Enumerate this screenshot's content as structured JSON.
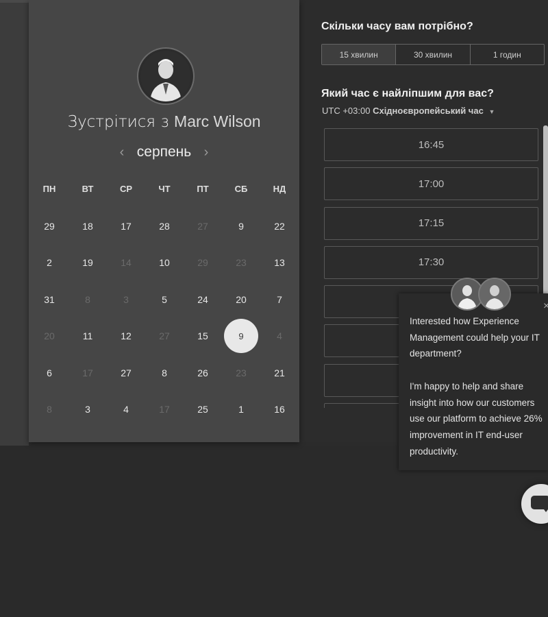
{
  "booking": {
    "title_prefix": "Зустрітися з",
    "host_name": "Marc Wilson",
    "month": "серпень",
    "weekdays": [
      "ПН",
      "ВТ",
      "СР",
      "ЧТ",
      "ПТ",
      "СБ",
      "НД"
    ],
    "weeks": [
      [
        {
          "d": "29",
          "dim": false
        },
        {
          "d": "18",
          "dim": false
        },
        {
          "d": "17",
          "dim": false
        },
        {
          "d": "28",
          "dim": false
        },
        {
          "d": "27",
          "dim": true
        },
        {
          "d": "9",
          "dim": false
        },
        {
          "d": "22",
          "dim": false
        }
      ],
      [
        {
          "d": "2",
          "dim": false
        },
        {
          "d": "19",
          "dim": false
        },
        {
          "d": "14",
          "dim": true
        },
        {
          "d": "10",
          "dim": false
        },
        {
          "d": "29",
          "dim": true
        },
        {
          "d": "23",
          "dim": true
        },
        {
          "d": "13",
          "dim": false
        }
      ],
      [
        {
          "d": "31",
          "dim": false
        },
        {
          "d": "8",
          "dim": true
        },
        {
          "d": "3",
          "dim": true
        },
        {
          "d": "5",
          "dim": false
        },
        {
          "d": "24",
          "dim": false
        },
        {
          "d": "20",
          "dim": false
        },
        {
          "d": "7",
          "dim": false
        }
      ],
      [
        {
          "d": "20",
          "dim": true
        },
        {
          "d": "11",
          "dim": false
        },
        {
          "d": "12",
          "dim": false
        },
        {
          "d": "27",
          "dim": true
        },
        {
          "d": "15",
          "dim": false
        },
        {
          "d": "9",
          "dim": false,
          "selected": true
        },
        {
          "d": "4",
          "dim": true
        }
      ],
      [
        {
          "d": "6",
          "dim": false
        },
        {
          "d": "17",
          "dim": true
        },
        {
          "d": "27",
          "dim": false
        },
        {
          "d": "8",
          "dim": false
        },
        {
          "d": "26",
          "dim": false
        },
        {
          "d": "23",
          "dim": true
        },
        {
          "d": "21",
          "dim": false
        }
      ],
      [
        {
          "d": "8",
          "dim": true
        },
        {
          "d": "3",
          "dim": false
        },
        {
          "d": "4",
          "dim": false
        },
        {
          "d": "17",
          "dim": true
        },
        {
          "d": "25",
          "dim": false
        },
        {
          "d": "1",
          "dim": false
        },
        {
          "d": "16",
          "dim": false
        }
      ]
    ]
  },
  "duration": {
    "heading": "Скільки часу вам потрібно?",
    "options": [
      "15 хвилин",
      "30 хвилин",
      "1 годин"
    ]
  },
  "time": {
    "heading": "Який час є найліпшим для вас?",
    "tz_offset": "UTC +03:00",
    "tz_name": "Східноєвропейський час",
    "slots": [
      "16:45",
      "17:00",
      "17:15",
      "17:30",
      "",
      "",
      "",
      ""
    ]
  },
  "chat": {
    "message_1": "Interested how Experience Management could help your IT department?",
    "message_2": "I'm happy to help and share insight into how our customers use our platform to achieve 26% improvement in IT end-user productivity.",
    "close": "×"
  },
  "icons": {
    "prev": "‹",
    "next": "›",
    "caret": "▼"
  }
}
